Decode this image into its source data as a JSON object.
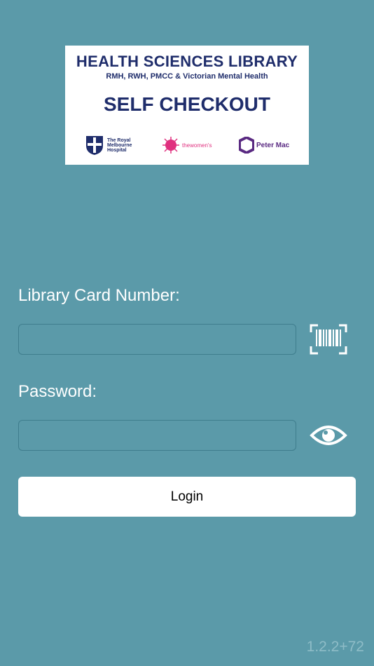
{
  "banner": {
    "title": "HEALTH SCIENCES LIBRARY",
    "subtitle": "RMH, RWH, PMCC & Victorian Mental Health",
    "checkout": "SELF CHECKOUT",
    "logos": {
      "rmh": "The Royal Melbourne Hospital",
      "women": "thewomen's",
      "petermac": "Peter Mac"
    }
  },
  "form": {
    "card_label": "Library Card Number:",
    "card_value": "",
    "password_label": "Password:",
    "password_value": "",
    "login_label": "Login"
  },
  "icons": {
    "barcode": "barcode-scan-icon",
    "eye": "eye-icon"
  },
  "colors": {
    "background": "#5b9aa9",
    "banner_text": "#1f2d6b",
    "button": "#ffffff"
  },
  "version": "1.2.2+72"
}
